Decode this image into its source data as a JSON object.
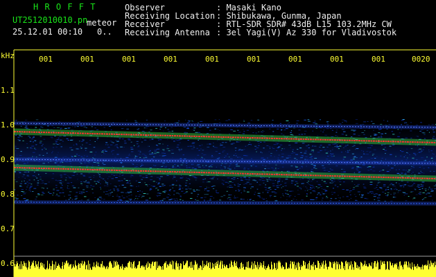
{
  "header": {
    "logo": "H R O F F T",
    "filename": "UT2512010010.pn",
    "meteor_label": "meteor",
    "timestamp": "25.12.01 00:10",
    "count": "0..",
    "fields": [
      {
        "label": "Observer",
        "value": ": Masaki Kano"
      },
      {
        "label": "Receiving Location",
        "value": ": Shibukawa, Gunma, Japan"
      },
      {
        "label": "Receiver",
        "value": ": RTL-SDR SDR# 43dB L15 103.2MHz CW"
      },
      {
        "label": "Receiving Antenna",
        "value": ": 3el Yagi(V) Az 330 for Vladivostok"
      }
    ]
  },
  "plot": {
    "unit": "kHz",
    "y_ticks": [
      "1.1",
      "1.0",
      "0.9",
      "0.8",
      "0.7",
      "0.6"
    ],
    "x_ticks": [
      "001",
      "001",
      "001",
      "001",
      "001",
      "001",
      "001",
      "001",
      "001",
      "0020"
    ],
    "colors": {
      "axis": "#ffff33",
      "background": "#000000",
      "signal": "#ff3030",
      "noise": "#1040c0"
    }
  }
}
